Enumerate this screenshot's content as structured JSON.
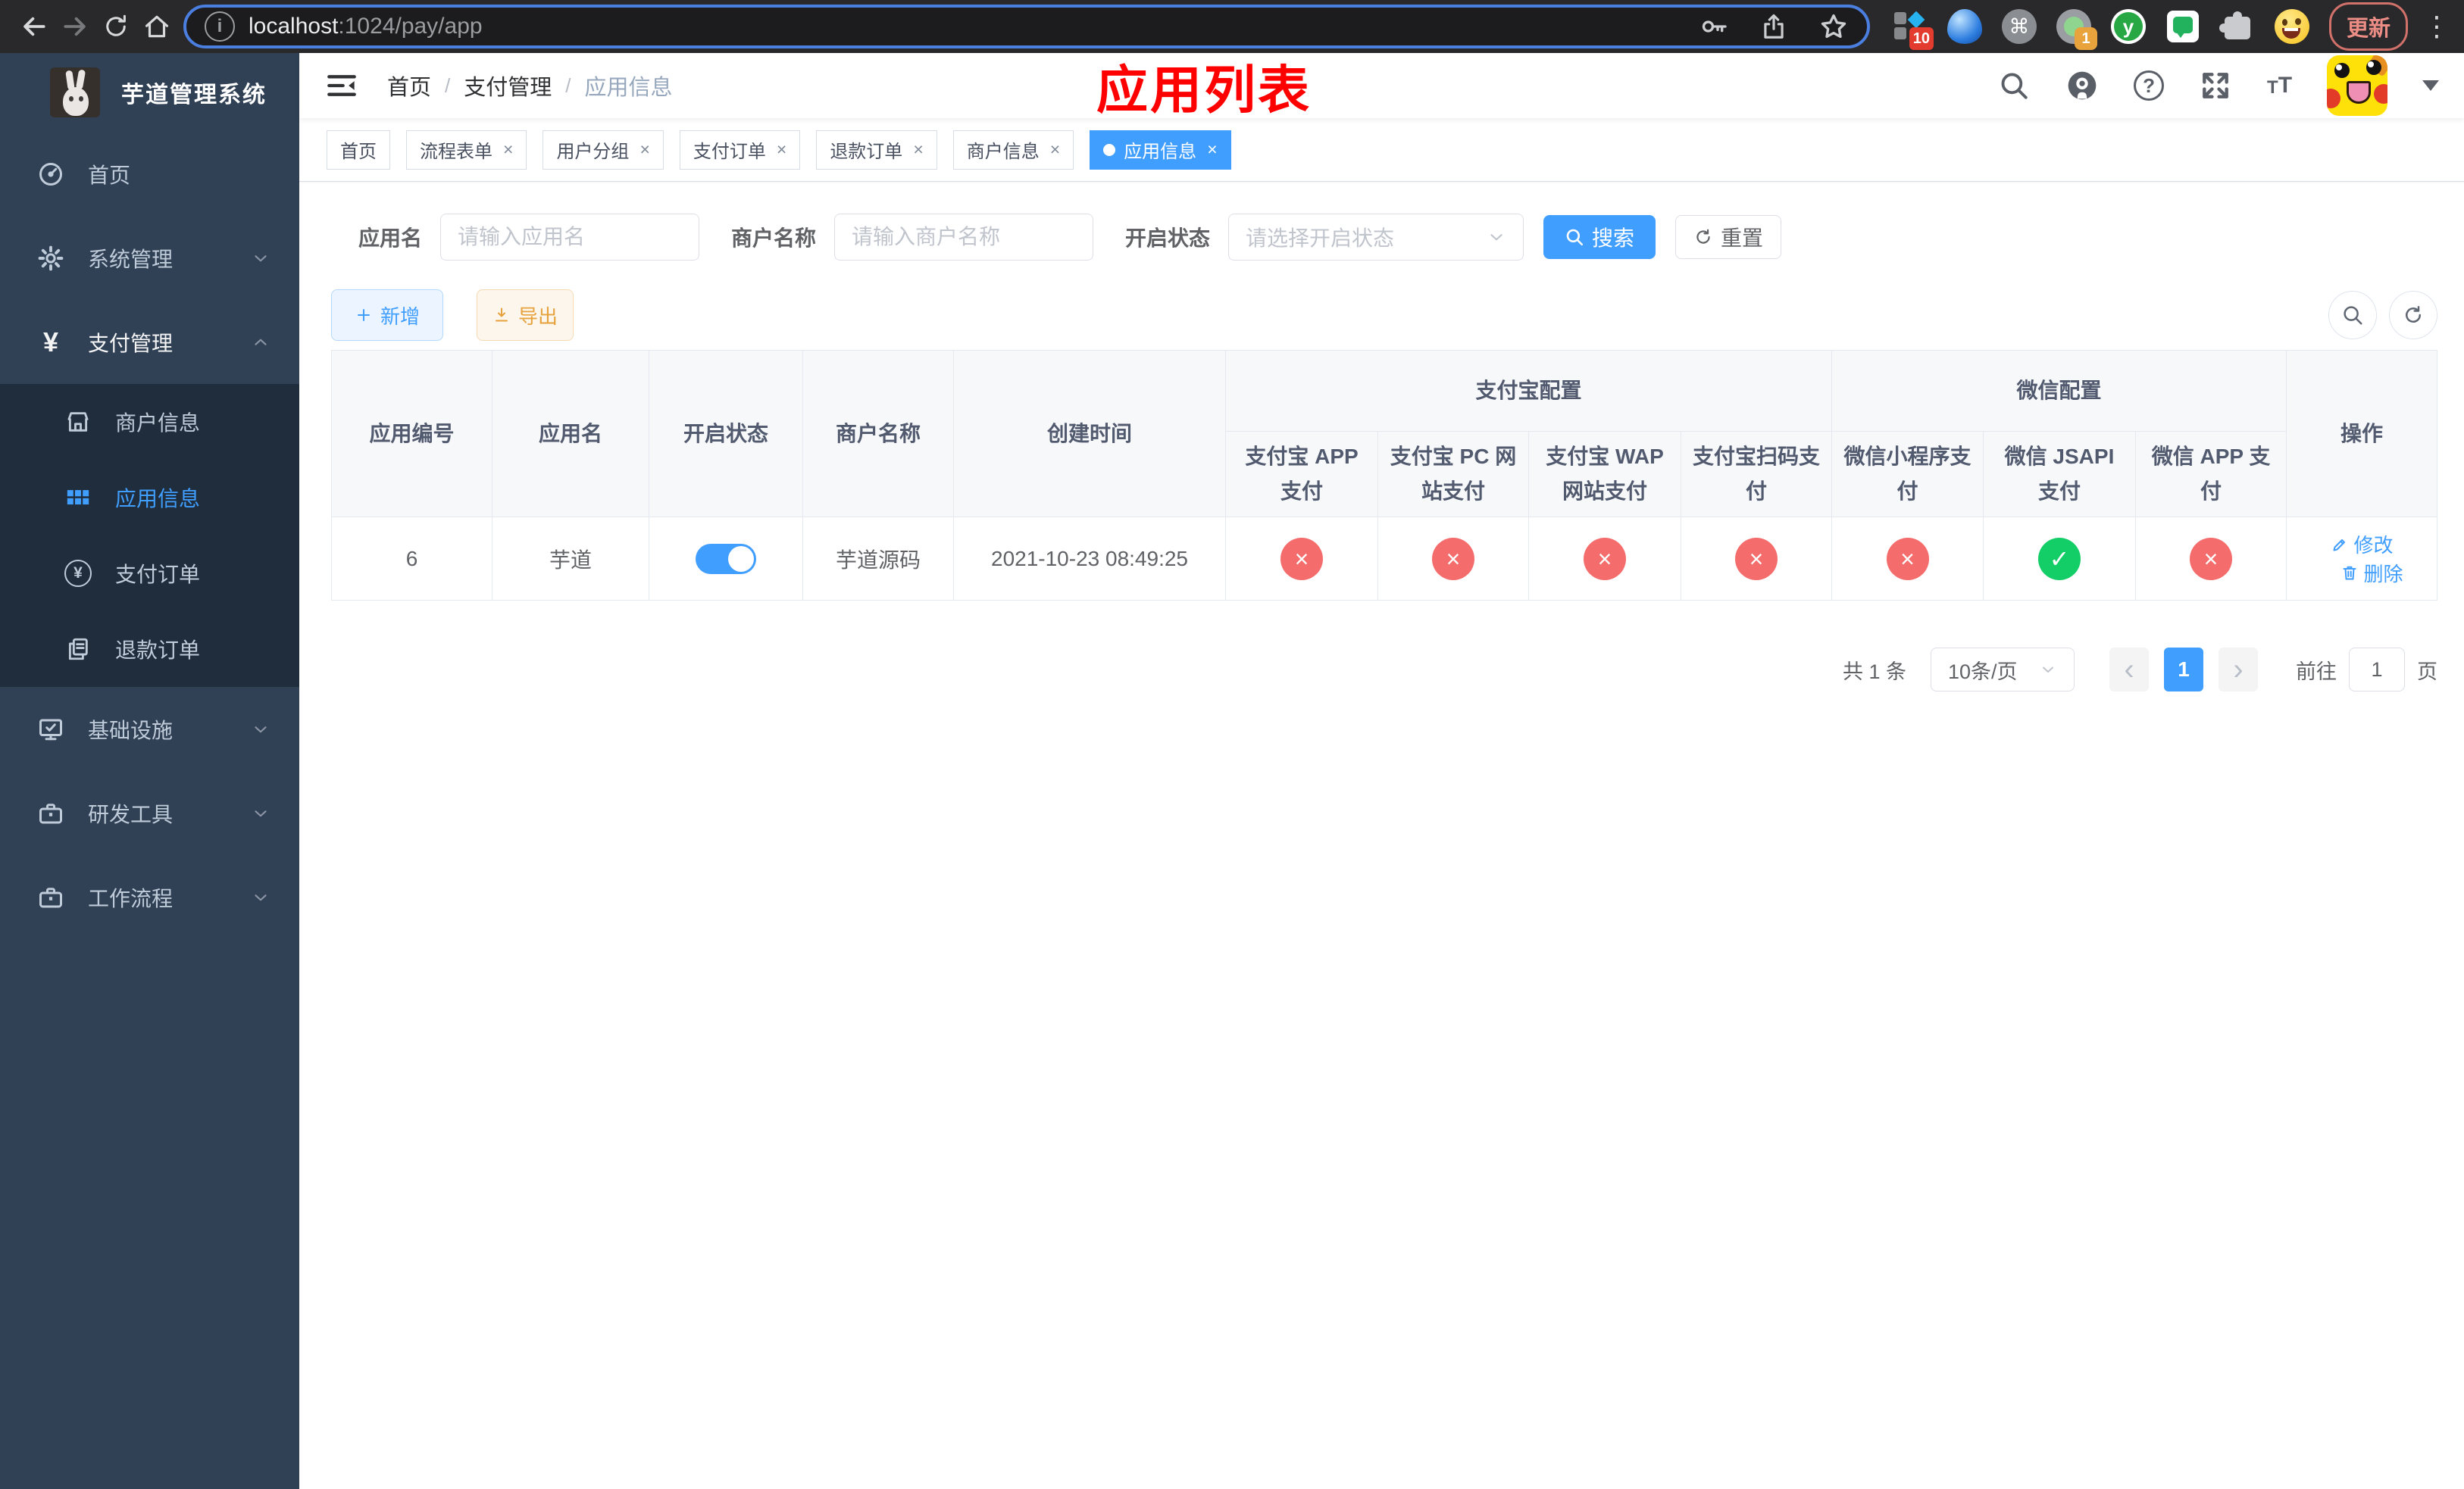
{
  "colors": {
    "accent": "#409eff",
    "danger": "#f56c6c",
    "success": "#13ce66",
    "warning": "#e6a23c",
    "annotation": "#ff0000",
    "sidebar_bg": "#304156",
    "submenu_bg": "#1f2d3d"
  },
  "browser": {
    "url_host": "localhost",
    "url_rest": ":1024/pay/app",
    "update_label": "更新",
    "badge_ten": "10",
    "badge_one": "1"
  },
  "sidebar": {
    "title": "芋道管理系统",
    "items": [
      {
        "label": "首页"
      },
      {
        "label": "系统管理"
      },
      {
        "label": "支付管理"
      },
      {
        "label": "基础设施"
      },
      {
        "label": "研发工具"
      },
      {
        "label": "工作流程"
      }
    ],
    "submenu": [
      {
        "label": "商户信息"
      },
      {
        "label": "应用信息"
      },
      {
        "label": "支付订单"
      },
      {
        "label": "退款订单"
      }
    ]
  },
  "header": {
    "breadcrumb": [
      "首页",
      "支付管理",
      "应用信息"
    ],
    "annotation": "应用列表"
  },
  "tabs": [
    {
      "label": "首页"
    },
    {
      "label": "流程表单"
    },
    {
      "label": "用户分组"
    },
    {
      "label": "支付订单"
    },
    {
      "label": "退款订单"
    },
    {
      "label": "商户信息"
    },
    {
      "label": "应用信息"
    }
  ],
  "filters": {
    "app_name_label": "应用名",
    "app_name_placeholder": "请输入应用名",
    "merchant_label": "商户名称",
    "merchant_placeholder": "请输入商户名称",
    "status_label": "开启状态",
    "status_placeholder": "请选择开启状态",
    "search_label": "搜索",
    "reset_label": "重置"
  },
  "toolbar": {
    "add_label": "新增",
    "export_label": "导出"
  },
  "table": {
    "columns": [
      "应用编号",
      "应用名",
      "开启状态",
      "商户名称",
      "创建时间"
    ],
    "group_alipay": "支付宝配置",
    "group_wechat": "微信配置",
    "alipay_cols": [
      "支付宝 APP 支付",
      "支付宝 PC 网站支付",
      "支付宝 WAP 网站支付",
      "支付宝扫码支付"
    ],
    "wechat_cols": [
      "微信小程序支付",
      "微信 JSAPI 支付",
      "微信 APP 支付"
    ],
    "ops_col": "操作",
    "row": {
      "id": "6",
      "name": "芋道",
      "enabled": true,
      "merchant": "芋道源码",
      "created": "2021-10-23 08:49:25",
      "statuses": [
        "no",
        "no",
        "no",
        "no",
        "no",
        "yes",
        "no"
      ],
      "edit_label": "修改",
      "delete_label": "删除"
    }
  },
  "pagination": {
    "total": "共 1 条",
    "page_size": "10条/页",
    "current": "1",
    "goto_label": "前往",
    "goto_value": "1",
    "goto_suffix": "页"
  }
}
